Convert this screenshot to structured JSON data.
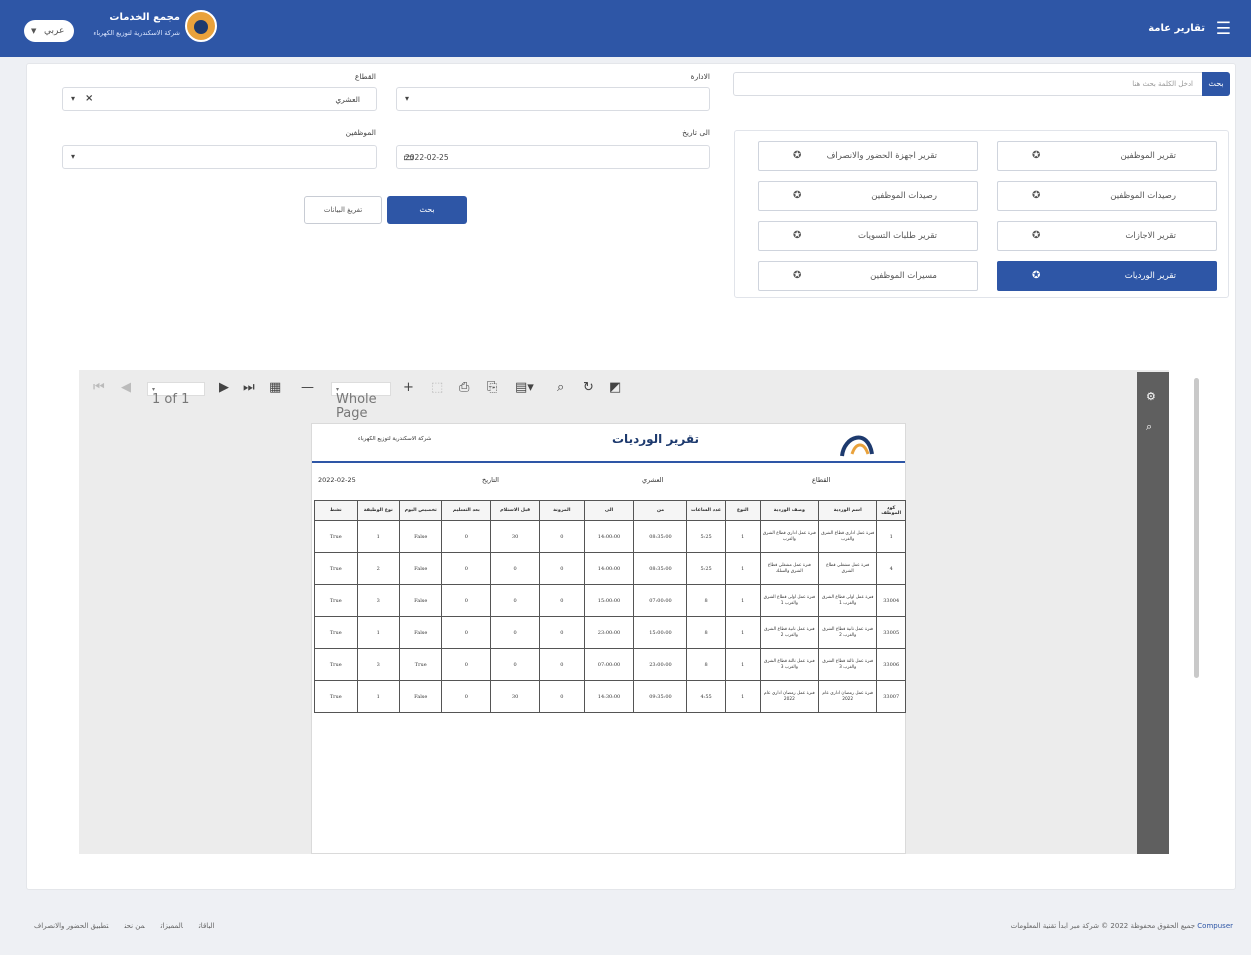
{
  "topbar": {
    "menu_label": "تقارير عامة",
    "brand_title": "مجمع الخدمات",
    "brand_subtitle": "شركة الاسكندرية لتوزيع الكهرباء",
    "lang_label": "عربي",
    "menu_icon": "hamburger-icon",
    "lang_arrow_icon": "caret-down-icon"
  },
  "filters": {
    "sector_label": "القطاع",
    "sector_value": "العشري",
    "department_label": "الادارة",
    "employees_label": "الموظفين",
    "to_date_label": "الى تاريخ",
    "to_date_value": "2022-02-25",
    "show_button": "بحث",
    "export_button": "تفريغ البيانات"
  },
  "search": {
    "button": "بحث",
    "placeholder": "ادخل الكلمة بحث هنا"
  },
  "reports": [
    {
      "label": "تقرير الموظفين",
      "active": false
    },
    {
      "label": "تقرير اجهزة الحضور والانصراف",
      "active": false
    },
    {
      "label": "رصيدات الموظفين",
      "active": false
    },
    {
      "label": "رصيدات الموظفين",
      "active": false
    },
    {
      "label": "تقرير الاجازات",
      "active": false
    },
    {
      "label": "تقرير طلبات التسويات",
      "active": false
    },
    {
      "label": "تقرير الورديات",
      "active": true
    },
    {
      "label": "مسيرات الموظفين",
      "active": false
    }
  ],
  "viewer": {
    "page_input": "1 of 1",
    "zoom_value": "Whole Page"
  },
  "report": {
    "title": "تقرير الورديات",
    "company": "شركة الاسكندرية لتوزيع الكهرباء",
    "sector_label": "القطاع",
    "sector_value": "العشري",
    "date_label": "التاريخ",
    "date_value": "2022-02-25",
    "columns": [
      "كود الموظف",
      "اسم الوردية",
      "وصف الوردية",
      "النوع",
      "عدد الساعات",
      "من",
      "الى",
      "المرونة",
      "قبل الاستلام",
      "بعد التسليم",
      "تخصيص اليوم",
      "نوع الوظيفة",
      "نشط"
    ],
    "rows": [
      [
        "1",
        "فترة عمل اداري قطاع الشرق والغرب",
        "فترة عمل اداري قطاع الشرق والغرب",
        "1",
        "5:25",
        "08:35:00",
        "14:00:00",
        "0",
        "30",
        "0",
        "False",
        "1",
        "True"
      ],
      [
        "4",
        "فترة عمل مشغلي قطاع الشرق",
        "فترة عمل مشغلي قطاع الشرق والسلك",
        "1",
        "5:25",
        "08:35:00",
        "14:00:00",
        "0",
        "0",
        "0",
        "False",
        "2",
        "True"
      ],
      [
        "33004",
        "فترة عمل اولى قطاع الشرق والغرب 1",
        "فترة عمل اولى قطاع الشرق والغرب 1",
        "1",
        "8",
        "07:00:00",
        "15:00:00",
        "0",
        "0",
        "0",
        "False",
        "3",
        "True"
      ],
      [
        "33005",
        "فترة عمل ثانية قطاع الشرق والغرب 2",
        "فترة عمل ثانية قطاع الشرق والغرب 2",
        "1",
        "8",
        "15:00:00",
        "23:00:00",
        "0",
        "0",
        "0",
        "False",
        "1",
        "True"
      ],
      [
        "33006",
        "فترة عمل ثالثة قطاع الشرق والغرب 3",
        "فترة عمل ثالثة قطاع الشرق والغرب 3",
        "1",
        "8",
        "23:00:00",
        "07:00:00",
        "0",
        "0",
        "0",
        "True",
        "3",
        "True"
      ],
      [
        "33007",
        "فترة عمل رمضان اداري عام 2022",
        "فترة عمل رمضان اداري عام 2022",
        "1",
        "4:55",
        "09:35:00",
        "14:30:00",
        "0",
        "30",
        "0",
        "False",
        "1",
        "True"
      ]
    ]
  },
  "footer": {
    "links": [
      "تطبيق الحضور والانصراف",
      "من نحن",
      "المميزات",
      "الباقات"
    ],
    "copyright_prefix": "جميع الحقوق محفوظة 2022 © شركة مبر ابدأ تقنية المعلومات",
    "brand": "Compuser"
  }
}
